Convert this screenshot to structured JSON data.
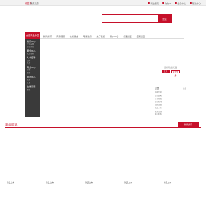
{
  "colors": {
    "accent": "#c6102a",
    "sidebar_bg": "#3a3a3a"
  },
  "topbar": {
    "login": "请登录",
    "register": "免费注册",
    "links": [
      {
        "icon": "home-icon",
        "label": "网站首页"
      },
      {
        "icon": "cart-icon",
        "label": "购物车"
      },
      {
        "icon": "user-icon",
        "label": "会员中心"
      },
      {
        "icon": "help-icon",
        "label": "帮助中心"
      }
    ]
  },
  "search": {
    "placeholder": "",
    "button": "搜索"
  },
  "nav": {
    "category_title": "全部商品分类",
    "links": [
      "新闻资讯",
      "商务服务",
      "在线留言",
      "联系我们",
      "关于我们",
      "客户中心",
      "代理加盟",
      "招商加盟"
    ]
  },
  "sidebar": {
    "groups": [
      {
        "title": "资讯中心",
        "items": [
          "行业动态",
          "企业新闻"
        ]
      },
      {
        "title": "服务中心",
        "items": [
          "售后服务"
        ]
      },
      {
        "title": "人才招聘",
        "items": [
          "招聘",
          "人才"
        ]
      },
      {
        "title": "商务中心",
        "items": [
          "合作",
          "案例"
        ]
      },
      {
        "title": "会员中心",
        "items": [
          "注册",
          "登录"
        ]
      },
      {
        "title": "在线客服",
        "items": [
          "客服"
        ]
      }
    ]
  },
  "user_panel": {
    "welcome": "您好欢迎光临",
    "login": "登录",
    "register": "免费注册"
  },
  "notice": {
    "title": "公告",
    "more": "更多",
    "items": [
      "新闻资讯",
      "公告通知",
      "行业动态",
      "企业新闻",
      "招商加盟",
      "新品上市",
      "优惠活动",
      "售后服务"
    ]
  },
  "section": {
    "title": "新闻资讯",
    "more": "新闻资讯"
  },
  "products": [
    {
      "name": "新品上市"
    },
    {
      "name": "新品上市"
    },
    {
      "name": "新品上市"
    },
    {
      "name": "新品上市"
    },
    {
      "name": "新品上市"
    }
  ]
}
